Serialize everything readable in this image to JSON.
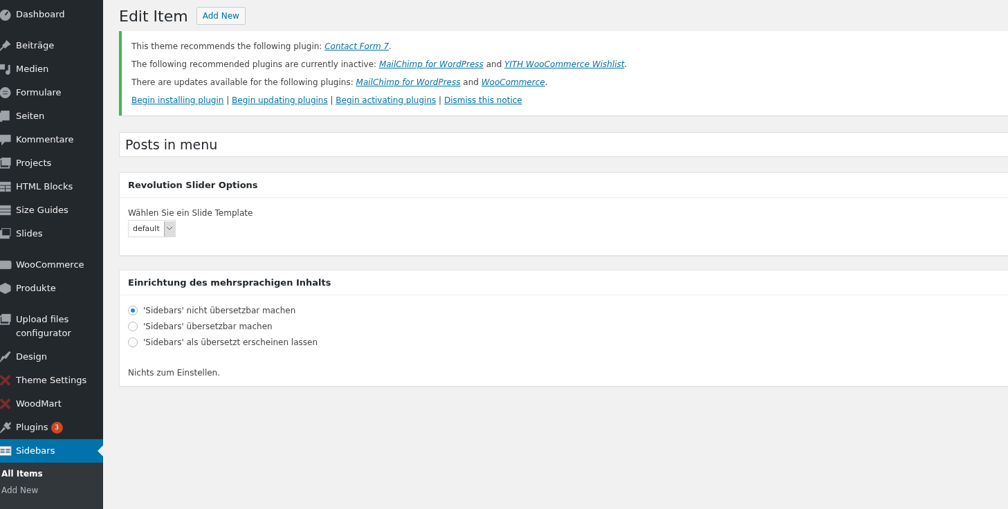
{
  "sidebar": {
    "groups": [
      [
        {
          "label": "Dashboard",
          "selected": false
        }
      ],
      [
        {
          "label": "Beiträge",
          "selected": false
        },
        {
          "label": "Medien",
          "selected": false
        },
        {
          "label": "Formulare",
          "selected": false
        },
        {
          "label": "Seiten",
          "selected": false
        },
        {
          "label": "Kommentare",
          "selected": false
        },
        {
          "label": "Projects",
          "selected": false
        },
        {
          "label": "HTML Blocks",
          "selected": false
        },
        {
          "label": "Size Guides",
          "selected": false
        },
        {
          "label": "Slides",
          "selected": false
        }
      ],
      [
        {
          "label": "WooCommerce",
          "selected": false
        },
        {
          "label": "Produkte",
          "selected": false
        }
      ],
      [
        {
          "label": "Upload files configurator",
          "selected": false
        },
        {
          "label": "Design",
          "selected": false
        },
        {
          "label": "Theme Settings",
          "selected": false
        },
        {
          "label": "WoodMart",
          "selected": false
        },
        {
          "label": "Plugins",
          "selected": false,
          "badge": "3"
        },
        {
          "label": "Sidebars",
          "selected": true
        }
      ]
    ],
    "submenu": [
      {
        "label": "All Items",
        "selected": true
      },
      {
        "label": "Add New",
        "selected": false
      }
    ]
  },
  "page": {
    "title": "Edit Item",
    "add_new_button": "Add New"
  },
  "notice": {
    "lines": [
      [
        {
          "kind": "text",
          "text": "This theme recommends the following plugin: "
        },
        {
          "kind": "link",
          "text": "Contact Form 7"
        },
        {
          "kind": "text",
          "text": "."
        }
      ],
      [
        {
          "kind": "text",
          "text": "The following recommended plugins are currently inactive: "
        },
        {
          "kind": "link",
          "text": "MailChimp for WordPress"
        },
        {
          "kind": "text",
          "text": " and "
        },
        {
          "kind": "link",
          "text": "YITH WooCommerce Wishlist"
        },
        {
          "kind": "text",
          "text": "."
        }
      ],
      [
        {
          "kind": "text",
          "text": "There are updates available for the following plugins: "
        },
        {
          "kind": "link",
          "text": "MailChimp for WordPress"
        },
        {
          "kind": "text",
          "text": " and "
        },
        {
          "kind": "link",
          "text": "WooCommerce"
        },
        {
          "kind": "text",
          "text": "."
        }
      ],
      [
        {
          "kind": "action",
          "text": "Begin installing plugin"
        },
        {
          "kind": "sep",
          "text": " | "
        },
        {
          "kind": "action",
          "text": "Begin updating plugins"
        },
        {
          "kind": "sep",
          "text": " | "
        },
        {
          "kind": "action",
          "text": "Begin activating plugins"
        },
        {
          "kind": "sep",
          "text": " | "
        },
        {
          "kind": "action",
          "text": "Dismiss this notice"
        }
      ]
    ]
  },
  "posts_in_menu": {
    "title": "Posts in menu"
  },
  "slider_options": {
    "title": "Revolution Slider Options",
    "label": "Wählen Sie ein Slide Template",
    "select_value": "default"
  },
  "multilingual": {
    "title": "Einrichtung des mehrsprachigen Inhalts",
    "options": [
      {
        "label": "'Sidebars' nicht übersetzbar machen",
        "selected": true
      },
      {
        "label": "'Sidebars' übersetzbar machen",
        "selected": false
      },
      {
        "label": "'Sidebars' als übersetzt erscheinen lassen",
        "selected": false
      }
    ],
    "note": "Nichts zum Einstellen."
  }
}
